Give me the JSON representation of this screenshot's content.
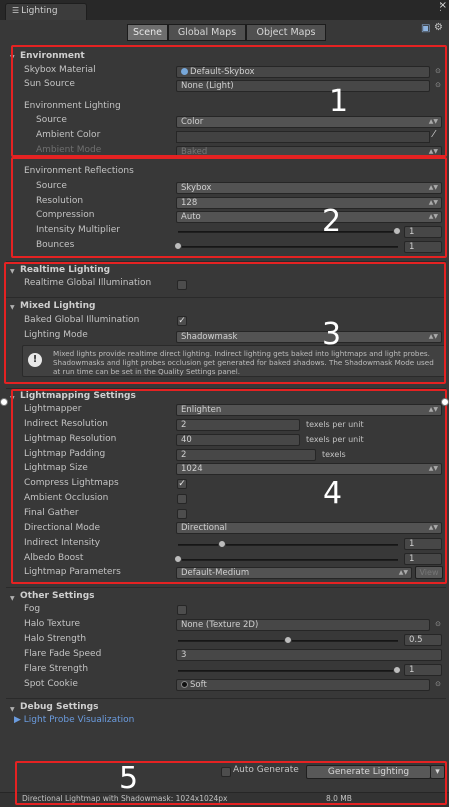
{
  "window": {
    "tab_title": "Lighting"
  },
  "tabs": [
    "Scene",
    "Global Maps",
    "Object Maps"
  ],
  "environment": {
    "header": "Environment",
    "skybox_label": "Skybox Material",
    "skybox_value": "Default-Skybox",
    "sun_label": "Sun Source",
    "sun_value": "None (Light)",
    "env_lighting_label": "Environment Lighting",
    "source_label": "Source",
    "source_value": "Color",
    "ambient_color_label": "Ambient Color",
    "ambient_mode_label": "Ambient Mode",
    "ambient_mode_value": "Baked"
  },
  "reflections": {
    "header": "Environment Reflections",
    "source_label": "Source",
    "source_value": "Skybox",
    "resolution_label": "Resolution",
    "resolution_value": "128",
    "compression_label": "Compression",
    "compression_value": "Auto",
    "intensity_label": "Intensity Multiplier",
    "intensity_value": "1",
    "bounces_label": "Bounces",
    "bounces_value": "1"
  },
  "realtime": {
    "header": "Realtime Lighting",
    "gi_label": "Realtime Global Illumination"
  },
  "mixed": {
    "header": "Mixed Lighting",
    "baked_gi_label": "Baked Global Illumination",
    "mode_label": "Lighting Mode",
    "mode_value": "Shadowmask",
    "help_text": "Mixed lights provide realtime direct lighting. Indirect lighting gets baked into lightmaps and light probes. Shadowmasks and light probes occlusion get generated for baked shadows. The Shadowmask Mode used at run time can be set in the Quality Settings panel."
  },
  "lightmapping": {
    "header": "Lightmapping Settings",
    "lightmapper_label": "Lightmapper",
    "lightmapper_value": "Enlighten",
    "indirect_res_label": "Indirect Resolution",
    "indirect_res_value": "2",
    "indirect_res_unit": "texels per unit",
    "lightmap_res_label": "Lightmap Resolution",
    "lightmap_res_value": "40",
    "lightmap_res_unit": "texels per unit",
    "padding_label": "Lightmap Padding",
    "padding_value": "2",
    "padding_unit": "texels",
    "size_label": "Lightmap Size",
    "size_value": "1024",
    "compress_label": "Compress Lightmaps",
    "ao_label": "Ambient Occlusion",
    "final_gather_label": "Final Gather",
    "directional_label": "Directional Mode",
    "directional_value": "Directional",
    "indirect_int_label": "Indirect Intensity",
    "indirect_int_value": "1",
    "albedo_label": "Albedo Boost",
    "albedo_value": "1",
    "params_label": "Lightmap Parameters",
    "params_value": "Default-Medium",
    "view_label": "View"
  },
  "other": {
    "header": "Other Settings",
    "fog_label": "Fog",
    "halo_tex_label": "Halo Texture",
    "halo_tex_value": "None (Texture 2D)",
    "halo_str_label": "Halo Strength",
    "halo_str_value": "0.5",
    "flare_fade_label": "Flare Fade Speed",
    "flare_fade_value": "3",
    "flare_str_label": "Flare Strength",
    "flare_str_value": "1",
    "spot_label": "Spot Cookie",
    "spot_value": "Soft"
  },
  "debug": {
    "header": "Debug Settings",
    "probe_link": "Light Probe Visualization"
  },
  "footer": {
    "auto_label": "Auto Generate",
    "generate_label": "Generate Lighting",
    "status_left": "Directional Lightmap with Shadowmask: 1024x1024px",
    "status_right": "8.0 MB"
  },
  "annotations": [
    "1",
    "2",
    "3",
    "4",
    "5"
  ],
  "colors": {
    "annotation_red": "#e52222",
    "panel_bg": "#383838",
    "link_blue": "#6b9cdf"
  },
  "checkboxes": {
    "realtime_gi": false,
    "baked_gi": true,
    "compress": true,
    "ao": false,
    "final_gather": false,
    "fog": false,
    "auto_generate": false
  },
  "sliders": {
    "intensity_multiplier": 1.0,
    "bounces": 0.0,
    "indirect_intensity": 0.22,
    "albedo_boost": 0.0,
    "halo_strength": 0.5,
    "flare_strength": 1.0
  }
}
